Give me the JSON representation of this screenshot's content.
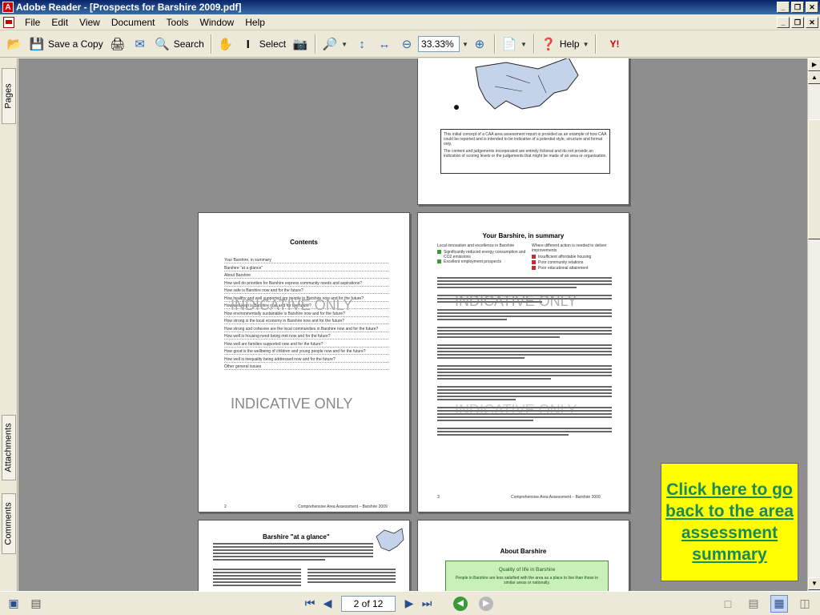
{
  "window": {
    "title": "Adobe Reader - [Prospects for Barshire 2009.pdf]",
    "controls": [
      "_",
      "❐",
      "✕"
    ]
  },
  "menu": {
    "items": [
      "File",
      "Edit",
      "View",
      "Document",
      "Tools",
      "Window",
      "Help"
    ]
  },
  "toolbar": {
    "save_copy_label": "Save a Copy",
    "search_label": "Search",
    "select_label": "Select",
    "zoom_value": "33.33%",
    "help_label": "Help"
  },
  "left_panel": {
    "tabs": [
      "Pages",
      "Attachments",
      "Comments"
    ]
  },
  "pages": {
    "top_right": {
      "disclaimer_1": "This initial concept of a CAA area assessment report is provided as an example of how CAA could be reported and is intended to be indicative of a potential style, structure and format only.",
      "disclaimer_2": "The content and judgements incorporated are entirely fictional and do not provide an indication of scoring levels or the judgements that might be made of an area or organisation."
    },
    "contents": {
      "title": "Contents",
      "items": [
        "Your Barshire, in summary",
        "Barshire \"at a glance\"",
        "About Barshire",
        "How well do priorities for Barshire express community needs and aspirations?",
        "How safe is Barshire now and for the future?",
        "How healthy and well supported are people in Barshire now and for the future?",
        "How well kept is Barshire now and for the future?",
        "How environmentally sustainable is Barshire now and for the future?",
        "How strong is the local economy in Barshire now and for the future?",
        "How strong and cohesive are the local communities in Barshire now and for the future?",
        "How well is housing need being met now and for the future?",
        "How well are families supported now and for the future?",
        "How good is the wellbeing of children and young people now and for the future?",
        "How well is inequality being addressed now and for the future?",
        "Other general issues"
      ],
      "watermark_1": "INDICATIVE ONLY",
      "watermark_2": "INDICATIVE ONLY",
      "page_number": "2",
      "footer": "Comprehensive Area Assessment – Barshire 2009"
    },
    "summary": {
      "title": "Your Barshire, in summary",
      "col_left_head": "Local innovation and excellence in Barshire",
      "col_right_head": "Where different action is needed to deliver improvements",
      "left_points": [
        "Significantly reduced energy consumption and CO2 emissions",
        "Excellent employment prospects"
      ],
      "right_points": [
        "Insufficient affordable housing",
        "Poor community relations",
        "Poor educational attainment"
      ],
      "watermark_1": "INDICATIVE ONLY",
      "watermark_2": "INDICATIVE ONLY",
      "page_number": "3",
      "footer": "Comprehensive Area Assessment – Barshire 2009"
    },
    "glance": {
      "title": "Barshire \"at a glance\""
    },
    "about": {
      "title": "About Barshire",
      "box_title": "Quality of life in Barshire",
      "box_text": "People in Barshire are less satisfied with the area as a place to live than those in similar areas or nationally."
    }
  },
  "callout": {
    "text": "Click here to go back to the area assessment summary"
  },
  "status": {
    "page_indicator": "2 of 12"
  }
}
